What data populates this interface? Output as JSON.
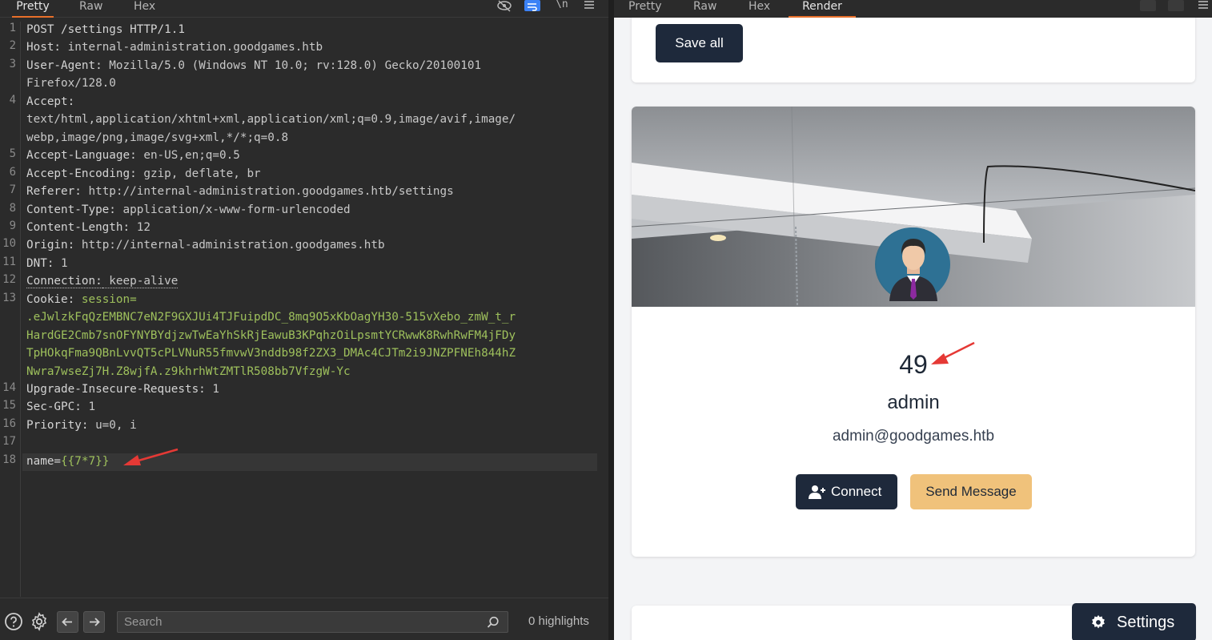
{
  "request_editor": {
    "tabs": [
      "Pretty",
      "Raw",
      "Hex"
    ],
    "active_tab": "Pretty",
    "toolbar_icons": [
      "eye-slash-icon",
      "wrap-icon",
      "newline-icon",
      "menu-icon"
    ],
    "newline_label": "\\n",
    "lines": [
      {
        "n": "1",
        "text": "POST /settings HTTP/1.1"
      },
      {
        "n": "2",
        "key": "Host:",
        "val": " internal-administration.goodgames.htb"
      },
      {
        "n": "3",
        "key": "User-Agent:",
        "val": " Mozilla/5.0 (Windows NT 10.0; rv:128.0) Gecko/20100101"
      },
      {
        "n": "",
        "val": "Firefox/128.0"
      },
      {
        "n": "4",
        "key": "Accept:",
        "val": ""
      },
      {
        "n": "",
        "val": "text/html,application/xhtml+xml,application/xml;q=0.9,image/avif,image/"
      },
      {
        "n": "",
        "val": "webp,image/png,image/svg+xml,*/*;q=0.8"
      },
      {
        "n": "5",
        "key": "Accept-Language:",
        "val": " en-US,en;q=0.5"
      },
      {
        "n": "6",
        "key": "Accept-Encoding:",
        "val": " gzip, deflate, br"
      },
      {
        "n": "7",
        "key": "Referer:",
        "val": " http://internal-administration.goodgames.htb/settings"
      },
      {
        "n": "8",
        "key": "Content-Type:",
        "val": " application/x-www-form-urlencoded"
      },
      {
        "n": "9",
        "key": "Content-Length:",
        "val": " 12"
      },
      {
        "n": "10",
        "key": "Origin:",
        "val": " http://internal-administration.goodgames.htb"
      },
      {
        "n": "11",
        "key": "DNT:",
        "val": " 1"
      },
      {
        "n": "12",
        "key": "Connection:",
        "val": " keep-alive"
      },
      {
        "n": "13",
        "key": "Cookie:",
        "val": " ",
        "green": "session="
      },
      {
        "n": "",
        "green": ".eJwlzkFqQzEMBNC7eN2F9GXJUi4TJFuipdDC_8mq9O5xKbOagYH30-515vXebo_zmW_t_r"
      },
      {
        "n": "",
        "green": "HardGE2Cmb7snOFYNYBYdjzwTwEaYhSkRjEawuB3KPqhzOiLpsmtYCRwwK8RwhRwFM4jFDy"
      },
      {
        "n": "",
        "green": "TpHOkqFma9QBnLvvQT5cPLVNuR55fmvwV3nddb98f2ZX3_DMAc4CJTm2i9JNZPFNEh844hZ"
      },
      {
        "n": "",
        "green": "Nwra7wseZj7H.Z8wjfA.z9khrhWtZMTlR508bb7VfzgW-Yc"
      },
      {
        "n": "14",
        "key": "Upgrade-Insecure-Requests:",
        "val": " 1"
      },
      {
        "n": "15",
        "key": "Sec-GPC:",
        "val": " 1"
      },
      {
        "n": "16",
        "key": "Priority:",
        "val": " u=0, i"
      },
      {
        "n": "17"
      },
      {
        "n": "18",
        "key": "name=",
        "green": "{{7*7}}"
      }
    ],
    "search_placeholder": "Search",
    "highlights": "0 highlights"
  },
  "render_view": {
    "tabs": [
      "Pretty",
      "Raw",
      "Hex",
      "Render"
    ],
    "active_tab": "Render",
    "save_button": "Save all",
    "profile": {
      "name": "49",
      "username": "admin",
      "email": "admin@goodgames.htb",
      "connect_label": "Connect",
      "message_label": "Send Message"
    },
    "settings_label": "Settings"
  },
  "colors": {
    "accent": "#e8702a",
    "annotation_arrow": "#e53935",
    "dark_button": "#1e293b",
    "amber_button": "#f0c27b"
  }
}
